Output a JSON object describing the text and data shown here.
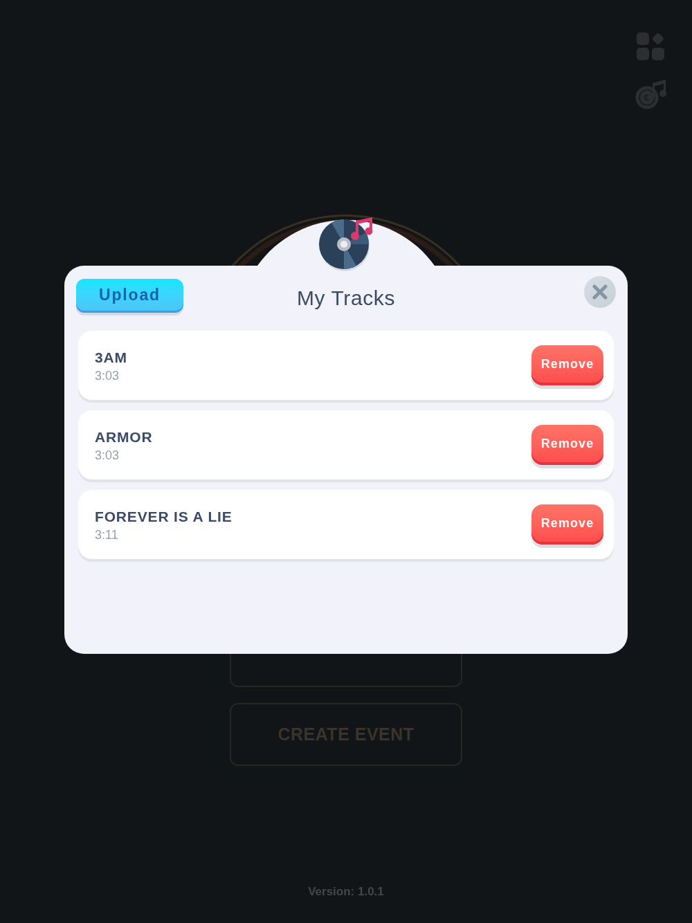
{
  "background": {
    "buttons": [
      {
        "kind": "outline"
      },
      {
        "kind": "outline",
        "label": "CREATE EVENT"
      }
    ],
    "version": "Version: 1.0.1"
  },
  "dialog": {
    "upload_button": "Upload",
    "title": "My Tracks",
    "tracks": [
      {
        "title": "3AM",
        "duration": "3:03",
        "button": "Remove"
      },
      {
        "title": "ARMOR",
        "duration": "3:03",
        "button": "Remove"
      },
      {
        "title": "FOREVER IS A LIE",
        "duration": "3:11",
        "button": "Remove"
      }
    ]
  }
}
